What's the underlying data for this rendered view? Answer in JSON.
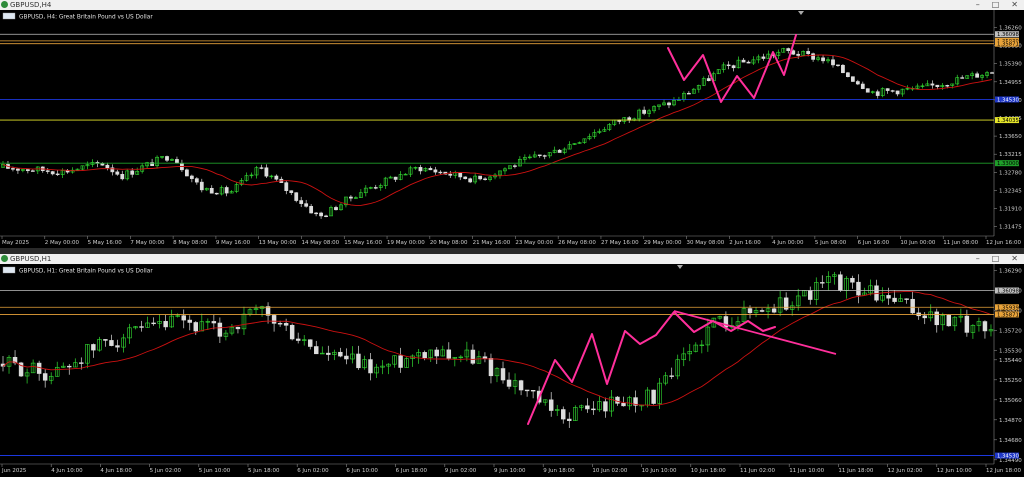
{
  "win1": {
    "title": "GBPUSD,H4",
    "label": "GBPUSD, H4:  Great Britain Pound vs US Dollar",
    "price_ticks": [
      "1.36260",
      "1.35830",
      "1.35390",
      "1.34955",
      "1.34520",
      "1.34085",
      "1.33650",
      "1.33215",
      "1.32780",
      "1.32345",
      "1.31910",
      "1.31475"
    ],
    "price_tick_values": [
      1.3626,
      1.3583,
      1.3539,
      1.34955,
      1.3452,
      1.34085,
      1.3365,
      1.33215,
      1.3278,
      1.32345,
      1.3191,
      1.31475
    ],
    "time_labels": [
      "May 2025",
      "2 May 00:00",
      "5 May 16:00",
      "7 May 00:00",
      "8 May 08:00",
      "9 May 16:00",
      "13 May 00:00",
      "14 May 08:00",
      "15 May 16:00",
      "19 May 00:00",
      "20 May 08:00",
      "21 May 16:00",
      "23 May 00:00",
      "26 May 08:00",
      "27 May 16:00",
      "29 May 00:00",
      "30 May 08:00",
      "2 Jun 16:00",
      "4 Jun 00:00",
      "5 Jun 08:00",
      "6 Jun 16:00",
      "10 Jun 00:00",
      "11 Jun 08:00",
      "12 Jun 16:00"
    ],
    "levels": [
      {
        "label": "1.36098",
        "price": 1.36098,
        "color": "#c0c0c0",
        "badge": "#c0c0c0",
        "text": "#000"
      },
      {
        "label": "1.35939",
        "price": 1.35939,
        "color": "#e8a33a",
        "badge": "#e8a33a",
        "text": "#000"
      },
      {
        "label": "1.35871",
        "price": 1.35871,
        "color": "#e8a33a",
        "badge": "#e8a33a",
        "text": "#000"
      },
      {
        "label": "1.34530",
        "price": 1.3453,
        "color": "#2040ff",
        "badge": "#1d36c8",
        "text": "#fff"
      },
      {
        "label": "1.34035",
        "price": 1.34035,
        "color": "#e5e52a",
        "badge": "#e5e52a",
        "text": "#000"
      },
      {
        "label": "1.33000",
        "price": 1.33,
        "color": "#1f9e2a",
        "badge": "#1f9e2a",
        "text": "#000"
      }
    ],
    "range": [
      1.3125,
      1.3668
    ]
  },
  "win2": {
    "title": "GBPUSD,H1",
    "label": "GBPUSD, H1:  Great Britain Pound vs US Dollar",
    "price_ticks": [
      "1.36290",
      "1.36100",
      "1.35910",
      "1.35720",
      "1.35530",
      "1.35440",
      "1.35250",
      "1.35060",
      "1.34870",
      "1.34680",
      "1.34490"
    ],
    "price_tick_values": [
      1.3629,
      1.361,
      1.3591,
      1.3572,
      1.3553,
      1.3544,
      1.3525,
      1.3506,
      1.3487,
      1.3468,
      1.3449
    ],
    "time_labels": [
      "Jun 2025",
      "4 Jun 10:00",
      "4 Jun 18:00",
      "5 Jun 02:00",
      "5 Jun 10:00",
      "5 Jun 18:00",
      "6 Jun 02:00",
      "6 Jun 10:00",
      "6 Jun 18:00",
      "9 Jun 02:00",
      "9 Jun 10:00",
      "9 Jun 18:00",
      "10 Jun 02:00",
      "10 Jun 10:00",
      "10 Jun 18:00",
      "11 Jun 02:00",
      "11 Jun 10:00",
      "11 Jun 18:00",
      "12 Jun 02:00",
      "12 Jun 10:00",
      "12 Jun 18:00"
    ],
    "levels": [
      {
        "label": "1.36098",
        "price": 1.36098,
        "color": "#c0c0c0",
        "badge": "#c0c0c0",
        "text": "#000"
      },
      {
        "label": "1.35939",
        "price": 1.35939,
        "color": "#e8a33a",
        "badge": "#e8a33a",
        "text": "#000"
      },
      {
        "label": "1.35871",
        "price": 1.35871,
        "color": "#e8a33a",
        "badge": "#e8a33a",
        "text": "#000"
      },
      {
        "label": "1.34530",
        "price": 1.3453,
        "color": "#2040ff",
        "badge": "#1d36c8",
        "text": "#fff"
      }
    ],
    "range": [
      1.3445,
      1.3635
    ]
  },
  "colors": {
    "bull": "#33dd33",
    "bear": "#dddddd",
    "ma": "#cc1111",
    "pattern": "#ff2f9b"
  }
}
